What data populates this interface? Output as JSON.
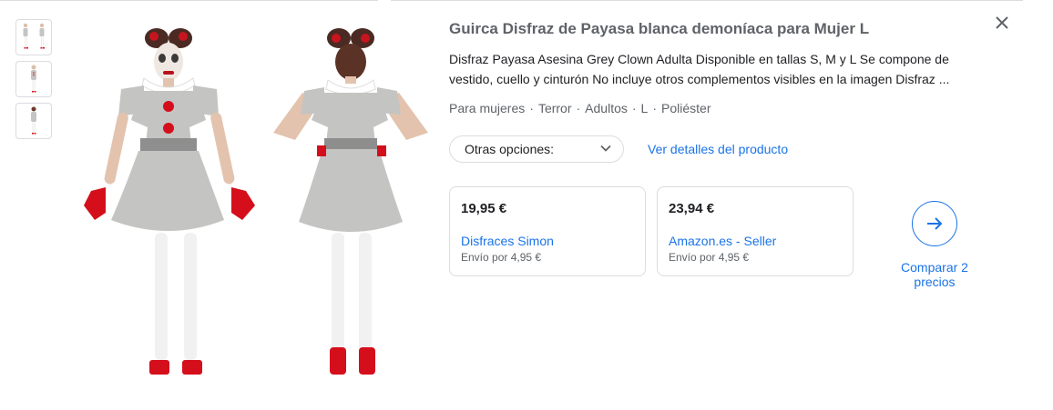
{
  "product": {
    "title": "Guirca Disfraz de Payasa blanca demoníaca para Mujer L",
    "description": "Disfraz Payasa Asesina Grey Clown Adulta Disponible en tallas S, M y L Se compone de vestido, cuello y cinturón No incluye otros complementos visibles en la imagen Disfraz ...",
    "attributes": [
      "Para mujeres",
      "Terror",
      "Adultos",
      "L",
      "Poliéster"
    ],
    "attribute_separator": "·"
  },
  "controls": {
    "options_label": "Otras opciones:",
    "details_link": "Ver detalles del producto",
    "compare_label": "Comparar 2 precios"
  },
  "offers": [
    {
      "price": "19,95 €",
      "store": "Disfraces Simon",
      "shipping": "Envío por 4,95 €"
    },
    {
      "price": "23,94 €",
      "store": "Amazon.es - Seller",
      "shipping": "Envío por 4,95 €"
    }
  ],
  "icons": {
    "close": "close-icon",
    "options": "chevron-down-icon",
    "compare": "arrow-right-icon"
  },
  "colors": {
    "link": "#1a73e8",
    "muted_text": "#5f6368",
    "border": "#dadce0",
    "dress": "#c4c4c2",
    "accent_red": "#d40f1b"
  }
}
